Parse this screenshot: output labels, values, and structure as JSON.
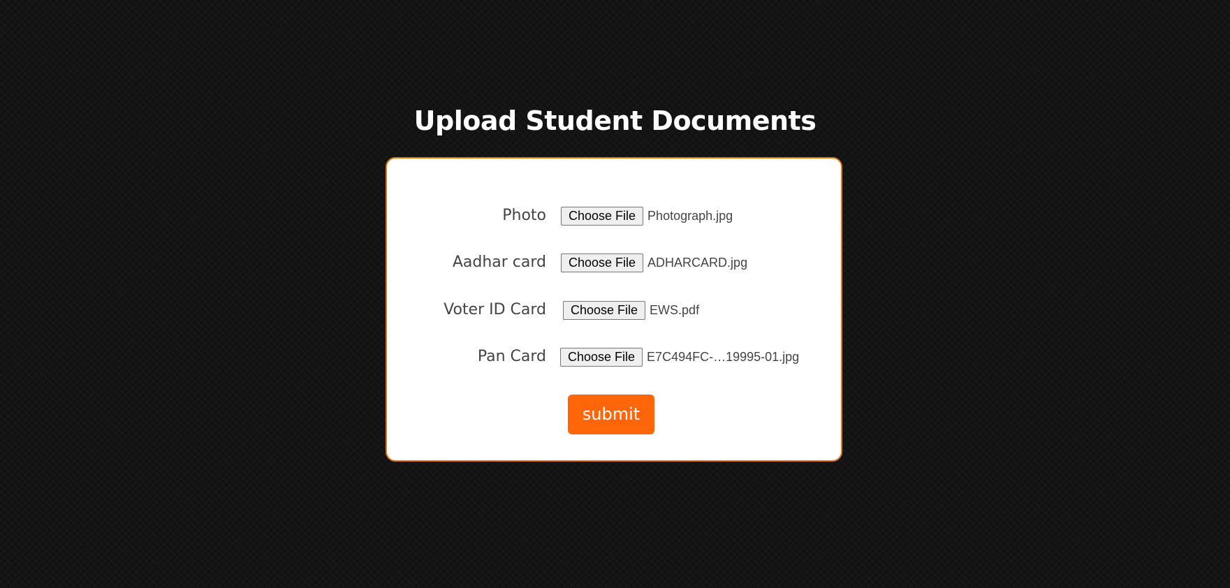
{
  "page": {
    "title": "Upload Student Documents"
  },
  "form": {
    "fields": [
      {
        "label": "Photo",
        "button_label": "Choose File",
        "file_name": "Photograph.jpg"
      },
      {
        "label": "Aadhar card",
        "button_label": "Choose File",
        "file_name": "ADHARCARD.jpg"
      },
      {
        "label": "Voter ID Card",
        "button_label": "Choose File",
        "file_name": "EWS.pdf"
      },
      {
        "label": "Pan Card",
        "button_label": "Choose File",
        "file_name": "E7C494FC-…19995-01.jpg"
      }
    ],
    "submit_label": "submit"
  },
  "colors": {
    "background": "#141414",
    "card_background": "#ffffff",
    "card_border": "#e07a10",
    "accent": "#ff6609",
    "label_text": "#444444"
  }
}
